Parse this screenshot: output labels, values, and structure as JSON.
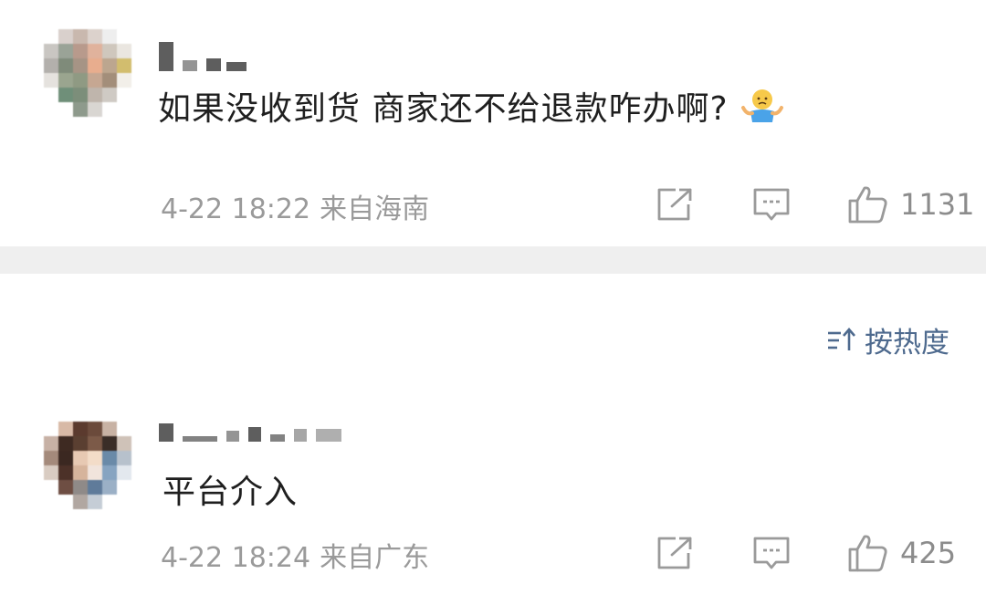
{
  "comments": [
    {
      "text": "如果没收到货 商家还不给退款咋办啊?",
      "emoji": "shrug-emoji",
      "time": "4-22 18:22",
      "location": "来自海南",
      "likes": "1131"
    },
    {
      "text": "平台介入",
      "time": "4-22 18:24",
      "location": "来自广东",
      "likes": "425"
    }
  ],
  "sort": {
    "label": "按热度",
    "icon": "sort-icon"
  },
  "colors": {
    "meta": "#9a9a9a",
    "accent": "#4e6a8e",
    "divider": "#efefef"
  }
}
